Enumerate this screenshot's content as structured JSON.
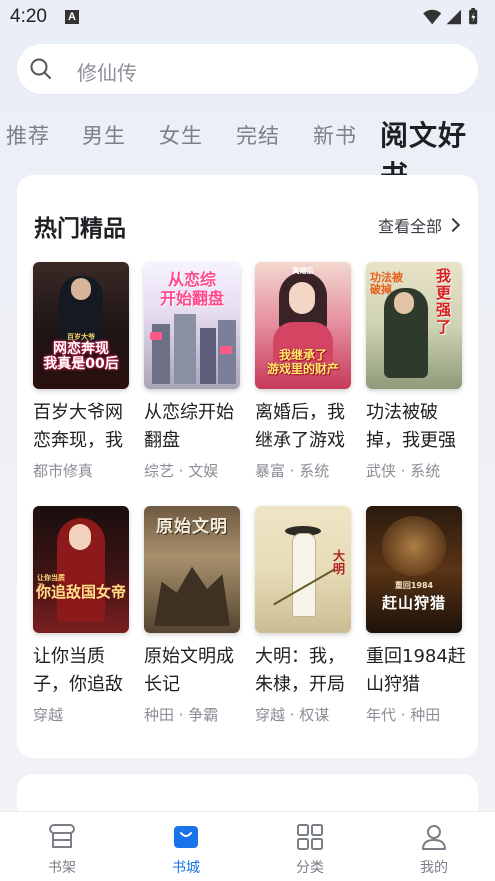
{
  "status_bar": {
    "time": "4:20",
    "notification_icon": "A"
  },
  "search": {
    "placeholder": "修仙传"
  },
  "tabs": [
    {
      "label": "推荐"
    },
    {
      "label": "男生"
    },
    {
      "label": "女生"
    },
    {
      "label": "完结"
    },
    {
      "label": "新书"
    },
    {
      "label": "阅文好书",
      "active": true
    }
  ],
  "section": {
    "title": "热门精品",
    "more_label": "查看全部",
    "books": [
      {
        "title": "百岁大爷网恋奔现，我",
        "tags": "都市修真",
        "cover_text": "网恋奔现\n我真是00后",
        "cover_top": "百岁大爷"
      },
      {
        "title": "从恋综开始翻盘",
        "tags": "综艺 · 文娱",
        "cover_text": "从恋综\n开始翻盘",
        "cover_top": ""
      },
      {
        "title": "离婚后，我继承了游戏",
        "tags": "暴富 · 系统",
        "cover_text": "我继承了\n游戏里的财产",
        "cover_top": "离婚后"
      },
      {
        "title": "功法被破掉，我更强",
        "tags": "武侠 · 系统",
        "cover_text": "我更强了",
        "cover_top": "功法被破掉"
      },
      {
        "title": "让你当质子，你追敌",
        "tags": "穿越",
        "cover_text": "你追敌国女帝",
        "cover_top": "让你当质子"
      },
      {
        "title": "原始文明成长记",
        "tags": "种田 · 争霸",
        "cover_text": "原始文明",
        "cover_top": ""
      },
      {
        "title": "大明：我，朱棣，开局",
        "tags": "穿越 · 权谋",
        "cover_text": "大明",
        "cover_top": ""
      },
      {
        "title": "重回1984赶山狩猎",
        "tags": "年代 · 种田",
        "cover_text": "赶山狩猎",
        "cover_top": "重回1984"
      }
    ]
  },
  "bottom_nav": [
    {
      "label": "书架",
      "icon": "bookshelf-icon"
    },
    {
      "label": "书城",
      "icon": "bookstore-bag-icon",
      "active": true
    },
    {
      "label": "分类",
      "icon": "grid-icon"
    },
    {
      "label": "我的",
      "icon": "person-icon"
    }
  ],
  "colors": {
    "accent": "#1a73e8",
    "text_primary": "#1e1f22",
    "text_secondary": "#8a8e96"
  }
}
